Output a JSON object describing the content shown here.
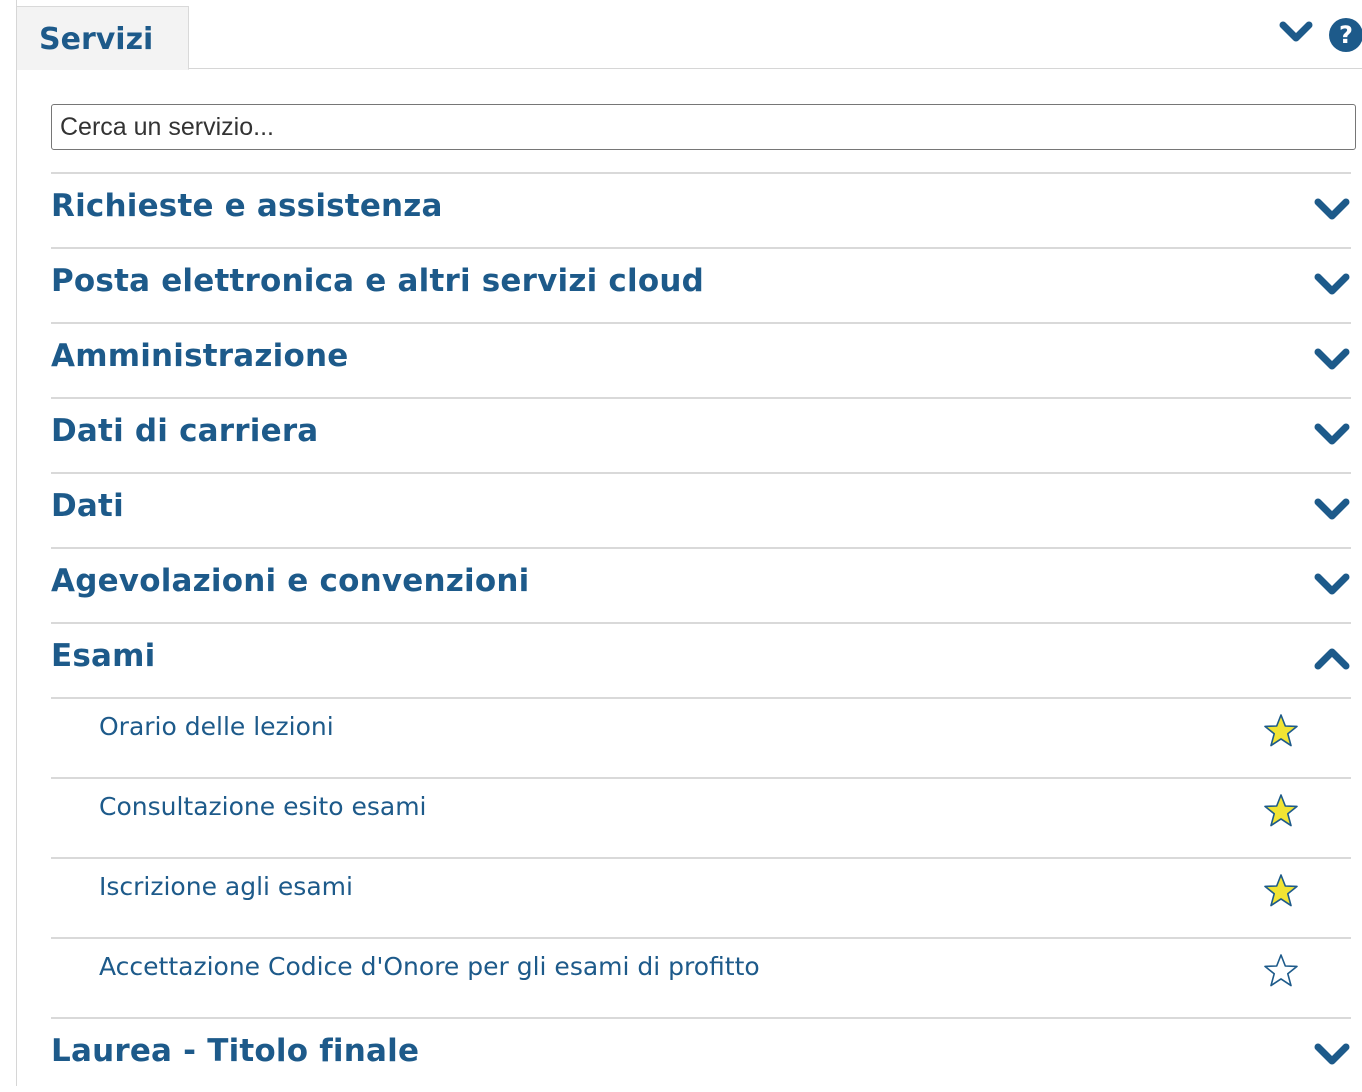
{
  "panel": {
    "tab_label": "Servizi",
    "collapse_icon": "chevron-down-icon",
    "help_icon": "question-circle-icon",
    "help_glyph": "?"
  },
  "search": {
    "placeholder": "Cerca un servizio...",
    "value": ""
  },
  "categories": [
    {
      "label": "Richieste e assistenza",
      "expanded": false
    },
    {
      "label": "Posta elettronica e altri servizi cloud",
      "expanded": false
    },
    {
      "label": "Amministrazione",
      "expanded": false
    },
    {
      "label": "Dati di carriera",
      "expanded": false
    },
    {
      "label": "Dati",
      "expanded": false
    },
    {
      "label": "Agevolazioni e convenzioni",
      "expanded": false
    },
    {
      "label": "Esami",
      "expanded": true,
      "services": [
        {
          "label": "Orario delle lezioni",
          "favorite": true
        },
        {
          "label": "Consultazione esito esami",
          "favorite": true
        },
        {
          "label": "Iscrizione agli esami",
          "favorite": true
        },
        {
          "label": "Accettazione Codice d'Onore per gli esami di profitto",
          "favorite": false
        }
      ]
    },
    {
      "label": "Laurea - Titolo finale",
      "expanded": false
    }
  ],
  "colors": {
    "accent": "#1d5a8a",
    "star_fill": "#f2e433",
    "star_outline": "#1d5a8a",
    "divider": "#d9d9d9"
  }
}
